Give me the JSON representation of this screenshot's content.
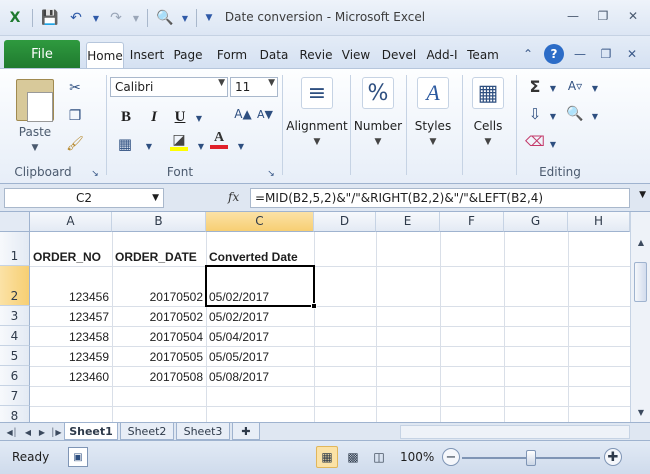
{
  "window": {
    "title": "Date conversion  -  Microsoft Excel"
  },
  "quick_access": {
    "icons": [
      "excel-logo-icon",
      "save-icon",
      "undo-icon",
      "redo-icon",
      "print-preview-icon",
      "customize-qat-icon"
    ]
  },
  "ribbon_tabs": {
    "file": "File",
    "tabs": [
      "Home",
      "Insert",
      "Page",
      "Form",
      "Data",
      "Revie",
      "View",
      "Devel",
      "Add-I",
      "Team"
    ],
    "active_index": 0
  },
  "ribbon": {
    "clipboard": {
      "paste_label": "Paste",
      "group_label": "Clipboard"
    },
    "font": {
      "font_name": "Calibri",
      "font_size": "11",
      "group_label": "Font",
      "bold": "B",
      "italic": "I",
      "underline": "U"
    },
    "alignment": {
      "label": "Alignment"
    },
    "number": {
      "label": "Number"
    },
    "styles": {
      "label": "Styles"
    },
    "cells": {
      "label": "Cells"
    },
    "editing": {
      "group_label": "Editing"
    }
  },
  "formula_bar": {
    "name_box": "C2",
    "fx": "fx",
    "formula": "=MID(B2,5,2)&\"/\"&RIGHT(B2,2)&\"/\"&LEFT(B2,4)"
  },
  "grid": {
    "columns": [
      "A",
      "B",
      "C",
      "D",
      "E",
      "F",
      "G",
      "H"
    ],
    "selected_column": "C",
    "rows": [
      "1",
      "2",
      "3",
      "4",
      "5",
      "6",
      "7",
      "8"
    ],
    "selected_row": "2",
    "headers": {
      "a": "ORDER_NO",
      "b": "ORDER_DATE",
      "c": "Converted Date"
    },
    "data": [
      {
        "a": "123456",
        "b": "20170502",
        "c": "05/02/2017"
      },
      {
        "a": "123457",
        "b": "20170502",
        "c": "05/02/2017"
      },
      {
        "a": "123458",
        "b": "20170504",
        "c": "05/04/2017"
      },
      {
        "a": "123459",
        "b": "20170505",
        "c": "05/05/2017"
      },
      {
        "a": "123460",
        "b": "20170508",
        "c": "05/08/2017"
      }
    ]
  },
  "sheets": {
    "tabs": [
      "Sheet1",
      "Sheet2",
      "Sheet3"
    ],
    "active_index": 0
  },
  "status_bar": {
    "status": "Ready",
    "zoom": "100%",
    "zoom_fraction": 0.5
  }
}
